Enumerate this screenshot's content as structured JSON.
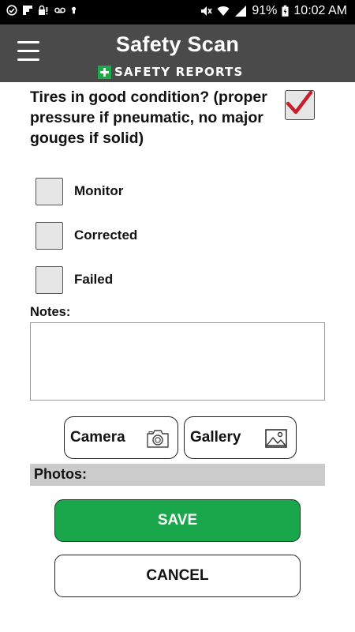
{
  "status_bar": {
    "battery_percent": "91%",
    "time": "10:02 AM",
    "icons_left": [
      "check-circle-icon",
      "flipboard-icon",
      "lock-warning-icon",
      "voicemail-icon",
      "keyhole-icon"
    ],
    "icons_right": [
      "mute-vibrate-icon",
      "wifi-icon",
      "cell-signal-icon",
      "battery-charging-icon"
    ]
  },
  "header": {
    "title": "Safety Scan",
    "brand": "SAFETY REPORTS",
    "brand_color": "#1ea84a",
    "background": "#4a4a4a"
  },
  "question": {
    "text": "Tires in good condition? (proper pressure if pneumatic, no major gouges if solid)",
    "checked": true,
    "check_color": "#c8202a"
  },
  "options": [
    {
      "label": "Monitor",
      "checked": false
    },
    {
      "label": "Corrected",
      "checked": false
    },
    {
      "label": "Failed",
      "checked": false
    }
  ],
  "notes": {
    "label": "Notes:",
    "value": "",
    "placeholder": ""
  },
  "photo_buttons": {
    "camera_label": "Camera",
    "gallery_label": "Gallery"
  },
  "photos": {
    "label": "Photos:"
  },
  "actions": {
    "save_label": "SAVE",
    "save_color": "#1aa64a",
    "cancel_label": "CANCEL"
  }
}
